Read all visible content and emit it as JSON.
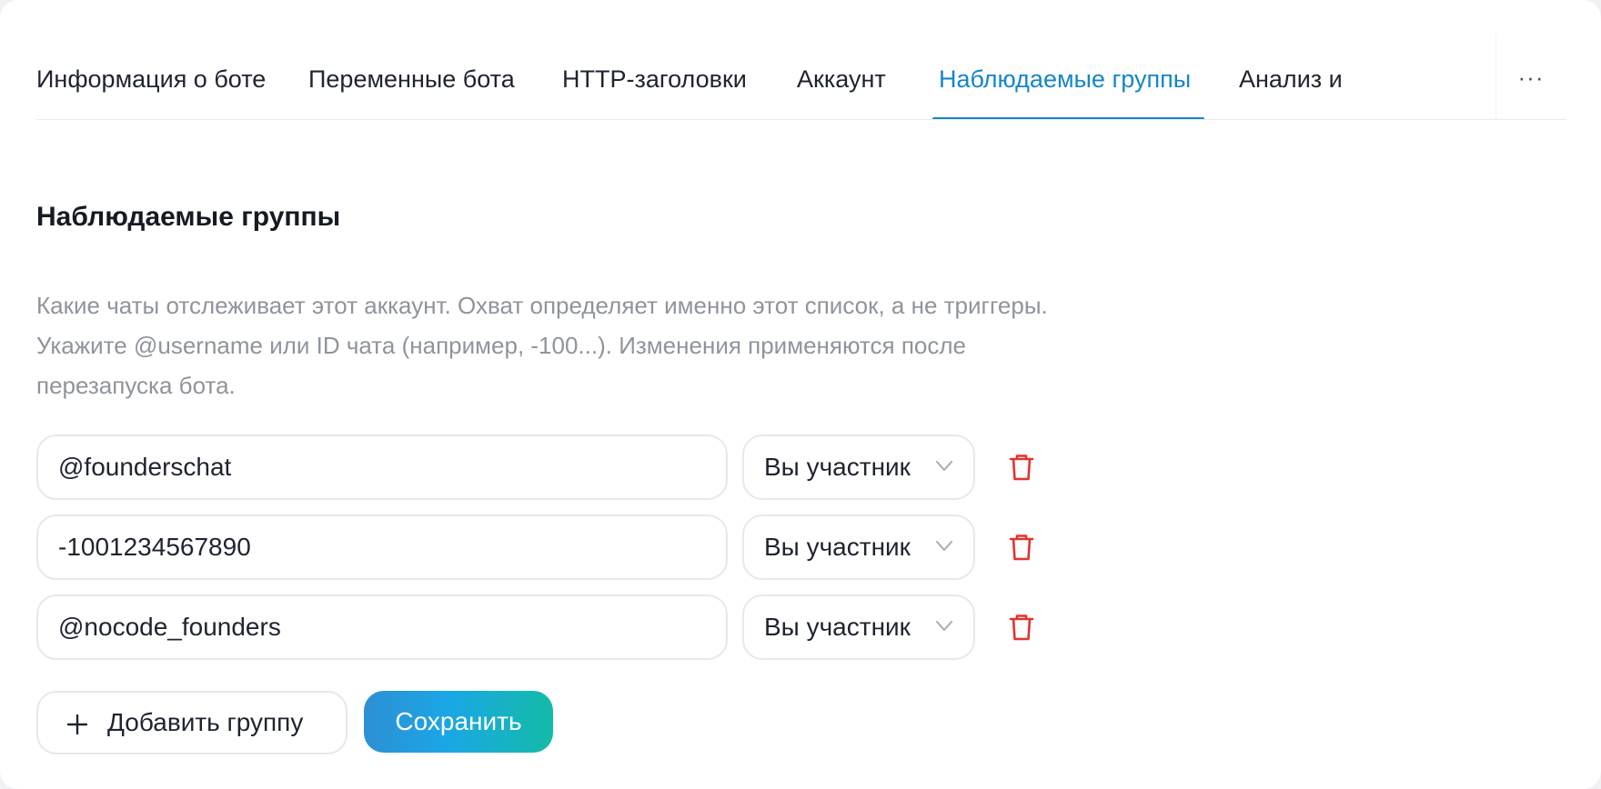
{
  "tabs": [
    {
      "label": "Информация о боте",
      "active": false
    },
    {
      "label": "Переменные бота",
      "active": false
    },
    {
      "label": "HTTP-заголовки",
      "active": false
    },
    {
      "label": "Аккаунт",
      "active": false
    },
    {
      "label": "Наблюдаемые группы",
      "active": true
    },
    {
      "label": "Анализ и",
      "active": false
    }
  ],
  "more_label": "···",
  "section": {
    "title": "Наблюдаемые группы",
    "description": "Какие чаты отслеживает этот аккаунт. Охват определяет именно этот список, а не триггеры. Укажите @username или ID чата (например, -100...). Изменения применяются после перезапуска бота."
  },
  "groups": [
    {
      "value": "@founderschat",
      "role": "Вы участник"
    },
    {
      "value": "-1001234567890",
      "role": "Вы участник"
    },
    {
      "value": "@nocode_founders",
      "role": "Вы участник"
    }
  ],
  "actions": {
    "add_label": "Добавить группу",
    "save_label": "Сохранить"
  },
  "icons": {
    "trash": "trash-icon",
    "chevron": "chevron-down-icon",
    "plus": "plus-icon"
  },
  "colors": {
    "accent": "#1586c9",
    "danger": "#e0352f",
    "muted_text": "#8f949c"
  }
}
